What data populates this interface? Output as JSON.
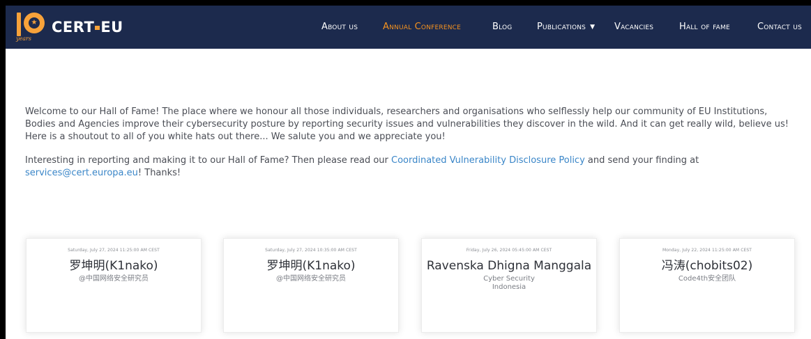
{
  "brand": {
    "name_left": "CERT",
    "name_right": "EU",
    "years_label": "years",
    "accent_color": "#f7a23a",
    "nav_bg_color": "#1c2a4d"
  },
  "nav": {
    "items": [
      {
        "label": "About us",
        "active": false
      },
      {
        "label": "Annual Conference",
        "active": true
      },
      {
        "label": "Blog",
        "active": false
      },
      {
        "label": "Publications",
        "active": false,
        "has_dropdown": true
      },
      {
        "label": "Vacancies",
        "active": false
      },
      {
        "label": "Hall of fame",
        "active": false
      },
      {
        "label": "Contact us",
        "active": false
      }
    ],
    "active_color": "#f7931e"
  },
  "intro": {
    "paragraph1": "Welcome to our Hall of Fame! The place where we honour all those individuals, researchers and organisations who selflessly help our community of EU Institutions, Bodies and Agencies improve their cybersecurity posture by reporting security issues and vulnerabilities they discover in the wild. And it can get really wild, believe us! Here is a shoutout to all of you white hats out there... We salute you and we appreciate you!",
    "paragraph2_before": "Interesting in reporting and making it to our Hall of Fame? Then please read our ",
    "policy_link": "Coordinated Vulnerability Disclosure Policy",
    "paragraph2_middle": " and send your finding at ",
    "email_link": "services@cert.europa.eu",
    "paragraph2_after": "! Thanks!",
    "link_color": "#3a86c8"
  },
  "cards": [
    {
      "date": "Saturday, July 27, 2024 11:25:00 AM CEST",
      "name": "罗坤明(K1nako)",
      "org_lines": [
        "@中国网络安全研究员"
      ]
    },
    {
      "date": "Saturday, July 27, 2024 10:35:00 AM CEST",
      "name": "罗坤明(K1nako)",
      "org_lines": [
        "@中国网络安全研究员"
      ]
    },
    {
      "date": "Friday, July 26, 2024 05:45:00 AM CEST",
      "name": "Ravenska Dhigna Manggala",
      "org_lines": [
        "Cyber Security",
        "Indonesia"
      ]
    },
    {
      "date": "Monday, July 22, 2024 11:25:00 AM CEST",
      "name": "冯涛(chobits02)",
      "org_lines": [
        "Code4th安全团队"
      ]
    }
  ]
}
